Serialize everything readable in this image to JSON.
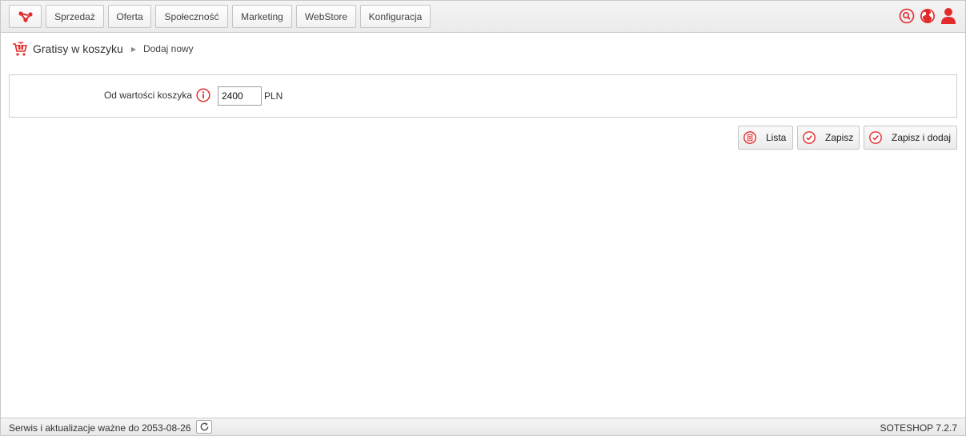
{
  "nav": {
    "logo_icon": "soteshop-logo-icon",
    "items": [
      {
        "label": "Sprzedaż"
      },
      {
        "label": "Oferta"
      },
      {
        "label": "Społeczność"
      },
      {
        "label": "Marketing"
      },
      {
        "label": "WebStore"
      },
      {
        "label": "Konfiguracja"
      }
    ],
    "right_icons": [
      "search-icon",
      "globe-icon",
      "user-icon"
    ]
  },
  "breadcrumb": {
    "icon": "gift-cart-icon",
    "title": "Gratisy w koszyku",
    "current": "Dodaj nowy"
  },
  "form": {
    "label": "Od wartości koszyka",
    "value": "2400",
    "unit": "PLN"
  },
  "actions": {
    "list_label": "Lista",
    "save_label": "Zapisz",
    "save_add_label": "Zapisz i dodaj"
  },
  "footer": {
    "service_text": "Serwis i aktualizacje ważne do 2053-08-26",
    "version": "SOTESHOP 7.2.7"
  },
  "colors": {
    "accent": "#e32b2b",
    "border": "#c8c8c8"
  }
}
